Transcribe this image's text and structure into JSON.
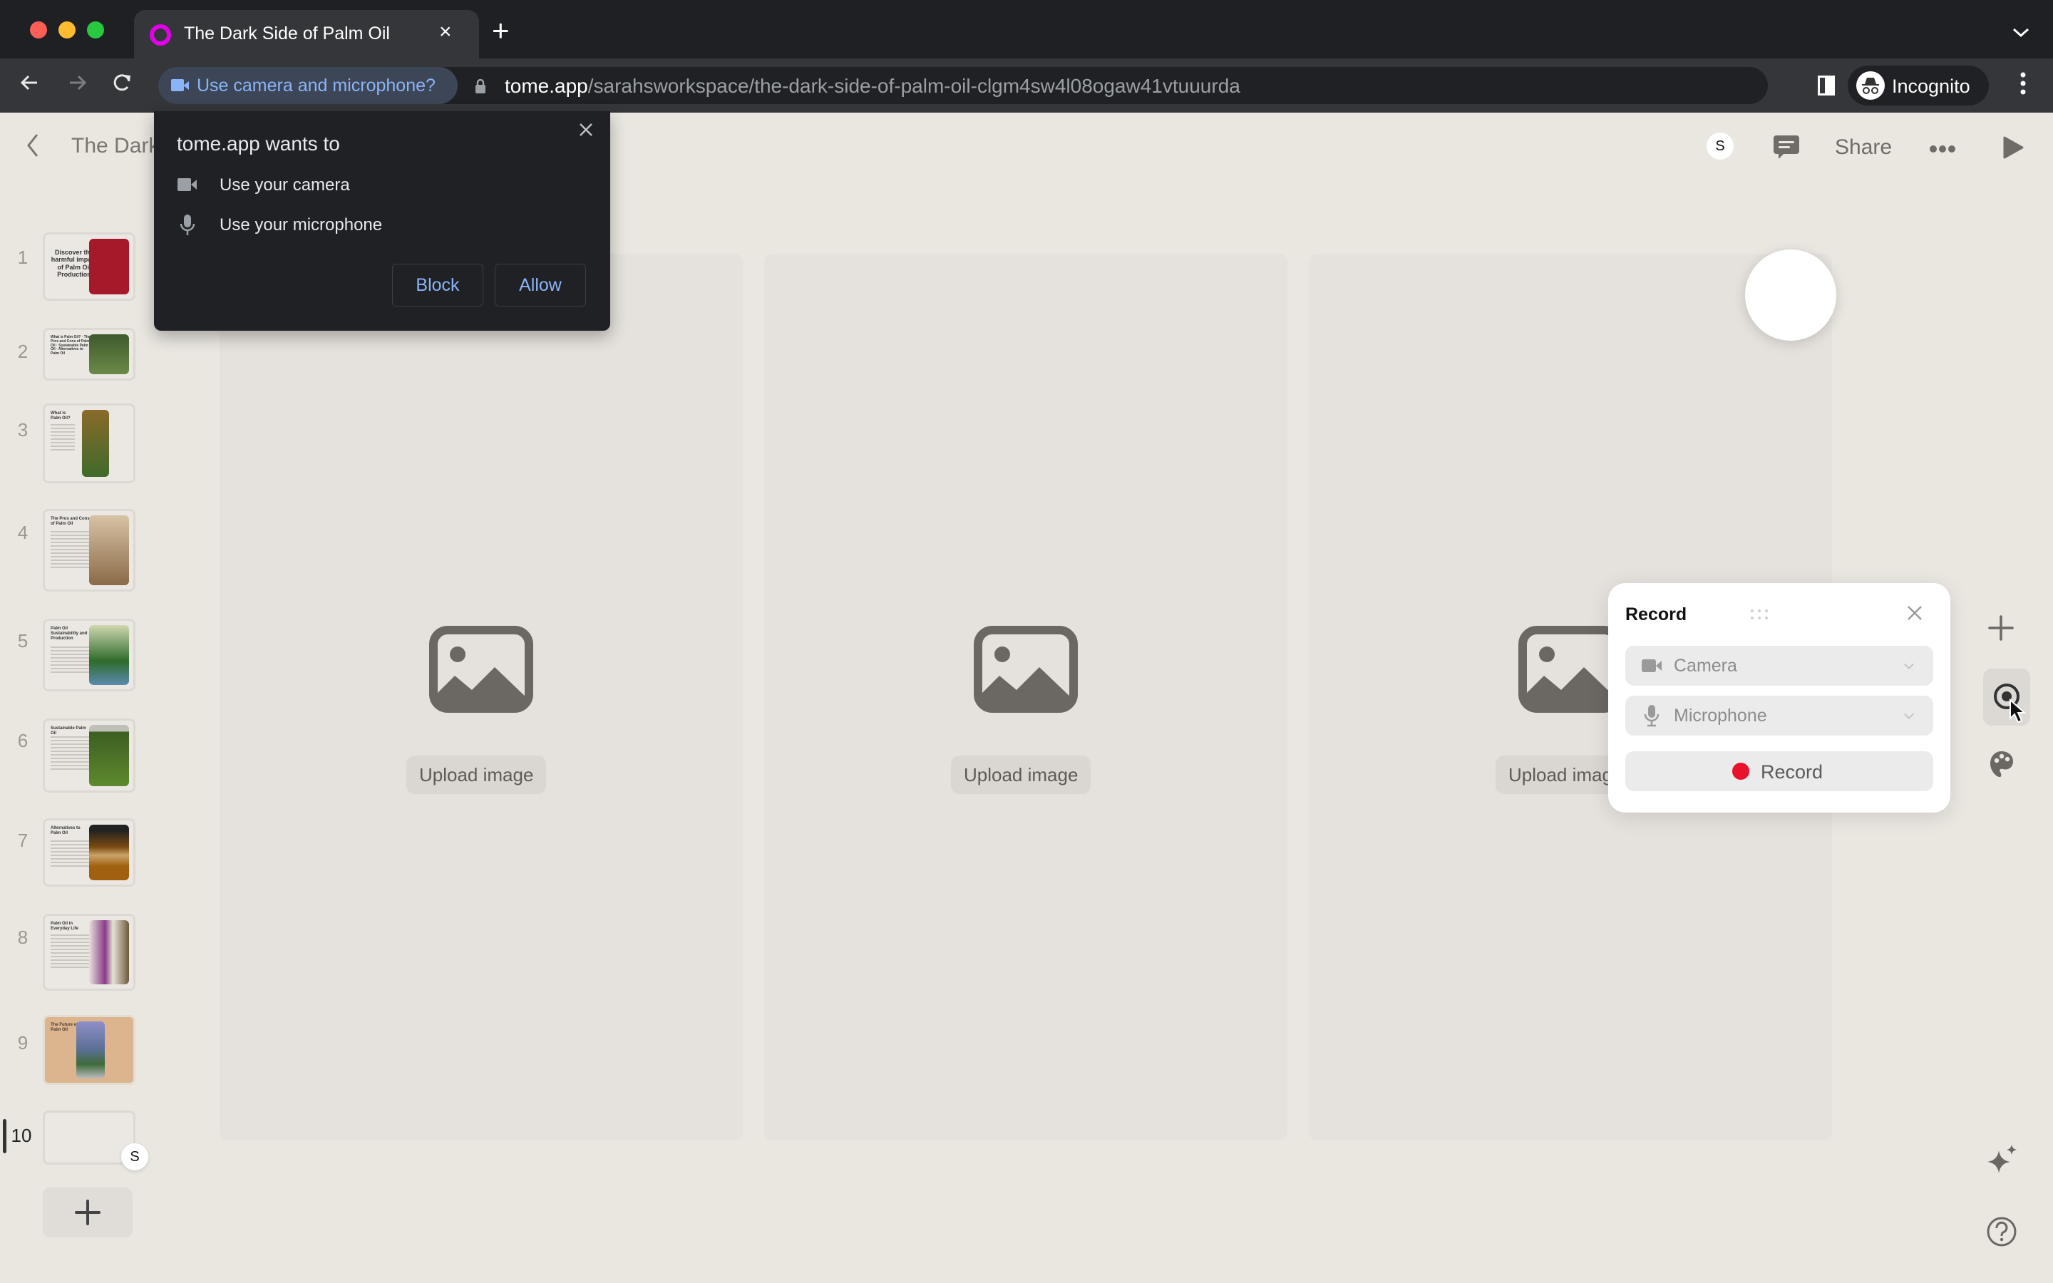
{
  "browser": {
    "tab_title": "The Dark Side of Palm Oil",
    "tab_close": "×",
    "new_tab": "+",
    "permission_chip": "Use camera and microphone?",
    "url_host": "tome.app",
    "url_path": "/sarahsworkspace/the-dark-side-of-palm-oil-clgm4sw4l08ogaw41vtuuurda",
    "profile_label": "Incognito",
    "colors": {
      "chrome_dark": "#1f2023",
      "toolbar": "#35363a",
      "link_blue": "#8ab4f8",
      "favicon": "#e100e8"
    }
  },
  "permission_popup": {
    "title": "tome.app wants to",
    "items": [
      {
        "icon": "camera-icon",
        "label": "Use your camera"
      },
      {
        "icon": "microphone-icon",
        "label": "Use your microphone"
      }
    ],
    "block_label": "Block",
    "allow_label": "Allow"
  },
  "app_header": {
    "doc_title": "The Dark Side of Palm Oil",
    "avatar_initial": "S",
    "share_label": "Share"
  },
  "slides": [
    {
      "number": "1",
      "title": "Discover the harmful impact of Palm Oil Production",
      "image_color": "#a5192b"
    },
    {
      "number": "2",
      "title": "What is Palm Oil? · The Pros and Cons of Palm Oil · Sustainable Palm Oil · Alternatives to Palm Oil",
      "image_color": "#4f6b3a"
    },
    {
      "number": "3",
      "title": "What is Palm Oil?",
      "image_color": "#556b2f"
    },
    {
      "number": "4",
      "title": "The Pros and Cons of Palm Oil",
      "image_color": "#b79a78"
    },
    {
      "number": "5",
      "title": "Palm Oil Sustainability and Production",
      "image_color": "#3e7a3a"
    },
    {
      "number": "6",
      "title": "Sustainable Palm Oil",
      "image_color": "#3d5e22"
    },
    {
      "number": "7",
      "title": "Alternatives to Palm Oil",
      "image_color": "#6b3f12"
    },
    {
      "number": "8",
      "title": "Palm Oil in Everyday Life",
      "image_color": "#5b5140"
    },
    {
      "number": "9",
      "title": "The Future of Palm Oil",
      "image_color": "#5a6f93"
    },
    {
      "number": "10",
      "title": "",
      "image_color": ""
    }
  ],
  "active_slide": "10",
  "slide10_avatar": "S",
  "canvas": {
    "upload_label": "Upload image",
    "upload_label_truncated": "Upload ima"
  },
  "record_panel": {
    "title": "Record",
    "camera_label": "Camera",
    "microphone_label": "Microphone",
    "record_label": "Record",
    "record_dot_color": "#e8132b"
  }
}
